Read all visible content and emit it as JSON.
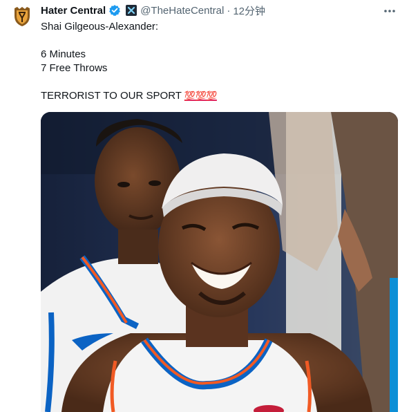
{
  "tweet": {
    "author": {
      "display_name": "Hater Central",
      "handle": "@TheHateCentral",
      "separator": "·",
      "time": "12分钟",
      "avatar_icon": "shield-crest-icon",
      "verified_icon": "verified-badge-icon",
      "affiliate_icon": "affiliate-x-badge-icon"
    },
    "text": {
      "line1": "Shai Gilgeous-Alexander:",
      "line2": "",
      "line3": "6 Minutes",
      "line4": "7 Free Throws",
      "line5": "",
      "line6": "TERRORIST TO OUR SPORT",
      "line6_emoji": "💯💯💯"
    },
    "media": {
      "type": "photo",
      "subject": "basketball-players-photo"
    },
    "colors": {
      "text": "#0f1419",
      "secondary": "#536471",
      "verified": "#1d9bf0",
      "emoji": "#e0245e"
    }
  }
}
